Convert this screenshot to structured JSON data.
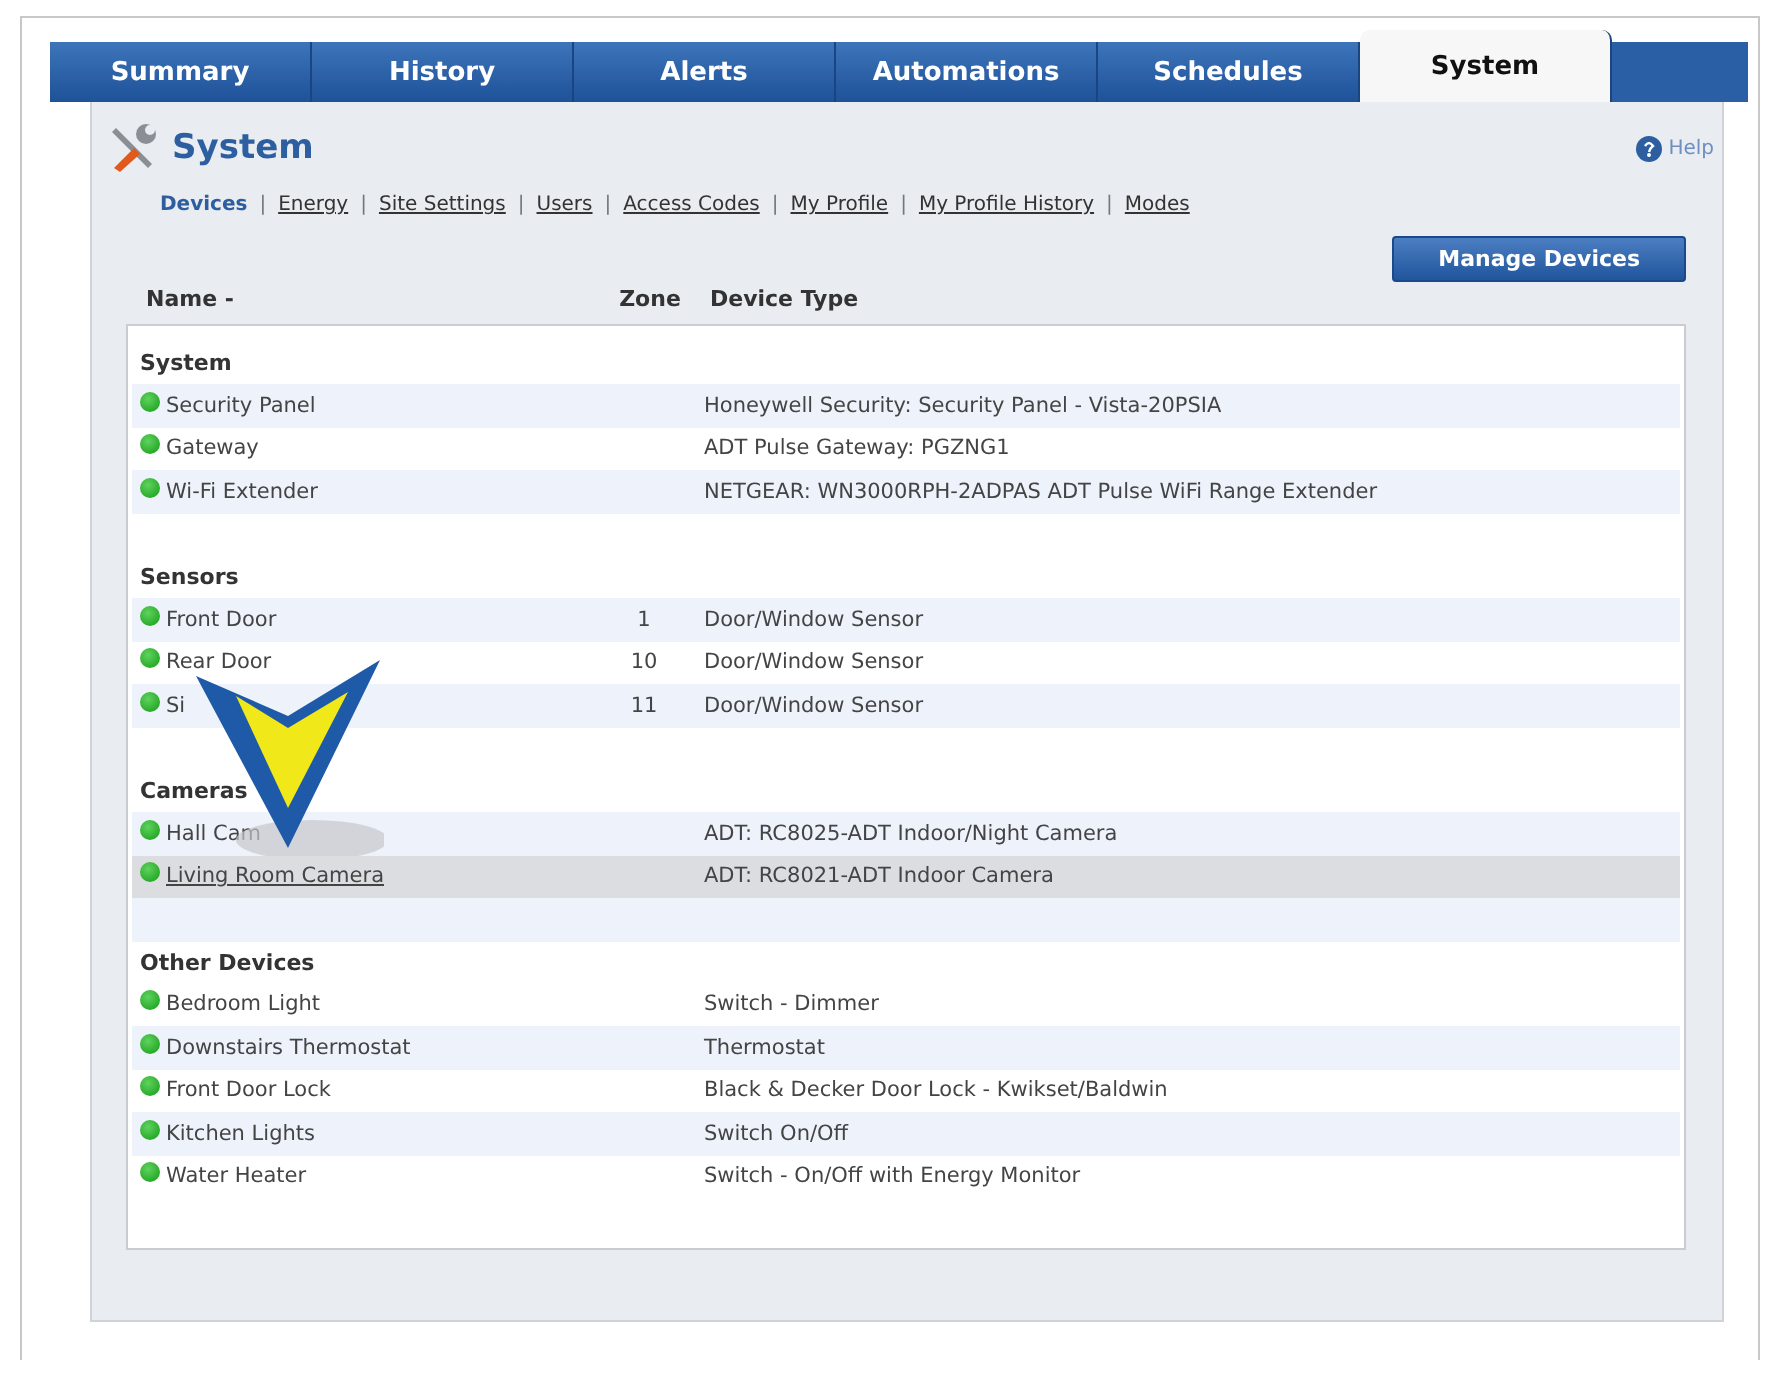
{
  "tabs": [
    {
      "label": "Summary",
      "selected": false
    },
    {
      "label": "History",
      "selected": false
    },
    {
      "label": "Alerts",
      "selected": false
    },
    {
      "label": "Automations",
      "selected": false
    },
    {
      "label": "Schedules",
      "selected": false
    },
    {
      "label": "System",
      "selected": true
    }
  ],
  "page_title": "System",
  "help": "Help",
  "subnav": [
    {
      "label": "Devices",
      "selected": true
    },
    {
      "label": "Energy",
      "selected": false
    },
    {
      "label": "Site Settings",
      "selected": false
    },
    {
      "label": "Users",
      "selected": false
    },
    {
      "label": "Access Codes",
      "selected": false
    },
    {
      "label": "My Profile",
      "selected": false
    },
    {
      "label": "My Profile History",
      "selected": false
    },
    {
      "label": "Modes",
      "selected": false
    }
  ],
  "separator": "|",
  "manage_button": "Manage Devices",
  "columns": [
    "Name -",
    "Zone",
    "Device Type"
  ],
  "groups": [
    {
      "name": "System",
      "devices": [
        {
          "name": "Security Panel",
          "type": "Honeywell Security: Security Panel - Vista-20PSIA",
          "selected": false
        },
        {
          "name": "Gateway",
          "type": "ADT Pulse Gateway: PGZNG1",
          "selected": false
        },
        {
          "name": "Wi-Fi Extender",
          "type": "NETGEAR: WN3000RPH-2ADPAS ADT Pulse WiFi Range Extender",
          "selected": false
        }
      ]
    },
    {
      "name": "Sensors",
      "devices": [
        {
          "name": "Front Door",
          "zone": "1",
          "type": "Door/Window Sensor",
          "selected": false
        },
        {
          "name": "Rear Door",
          "zone": "10",
          "type": "Door/Window Sensor",
          "selected": false
        },
        {
          "name": "Si",
          "zone": "11",
          "type": "Door/Window Sensor",
          "selected": false
        }
      ]
    },
    {
      "name": "Cameras",
      "devices": [
        {
          "name": "Hall Cam",
          "type": "ADT: RC8025-ADT Indoor/Night Camera",
          "selected": false
        },
        {
          "name": "Living Room Camera",
          "type": "ADT: RC8021-ADT Indoor Camera",
          "selected": true
        }
      ]
    },
    {
      "name": "Other Devices",
      "devices": [
        {
          "name": "Bedroom Light",
          "type": "Switch - Dimmer",
          "selected": false
        },
        {
          "name": "Downstairs Thermostat",
          "type": "Thermostat",
          "selected": false
        },
        {
          "name": "Front Door Lock",
          "type": "Black & Decker Door Lock - Kwikset/Baldwin",
          "selected": false
        },
        {
          "name": "Kitchen Lights",
          "type": "Switch On/Off",
          "selected": false
        },
        {
          "name": "Water Heater",
          "type": "Switch - On/Off with Energy Monitor",
          "selected": false
        }
      ]
    }
  ]
}
